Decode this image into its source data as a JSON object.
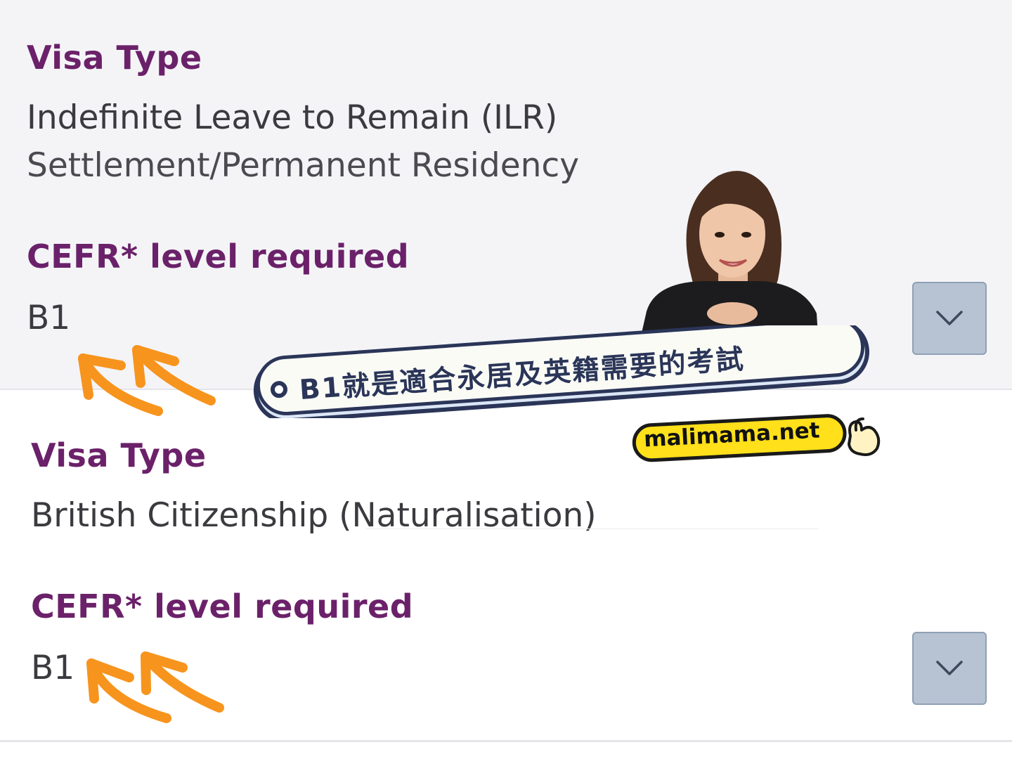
{
  "sections": [
    {
      "visa_type_label": "Visa Type",
      "visa_type_value": "Indefinite Leave to Remain (ILR)",
      "visa_type_subvalue": "Settlement/Permanent Residency",
      "cefr_label": "CEFR* level required",
      "cefr_value": "B1"
    },
    {
      "visa_type_label": "Visa Type",
      "visa_type_value": "British Citizenship (Naturalisation)",
      "cefr_label": "CEFR* level required",
      "cefr_value": "B1"
    }
  ],
  "overlay": {
    "banner_text": "B1就是適合永居及英籍需要的考試",
    "site_tag": "malimama.net"
  },
  "colors": {
    "label": "#6b2169",
    "text": "#3a3a3f",
    "card_bg": "#f4f4f7",
    "button_bg": "#b7c3d2",
    "arrow": "#f7941d",
    "banner_border": "#2a3558",
    "tag_bg": "#ffe01a"
  },
  "icons": {
    "expand": "chevron-down-icon",
    "arrows": "hand-drawn-arrow-icon",
    "hand": "pointing-hand-icon"
  }
}
